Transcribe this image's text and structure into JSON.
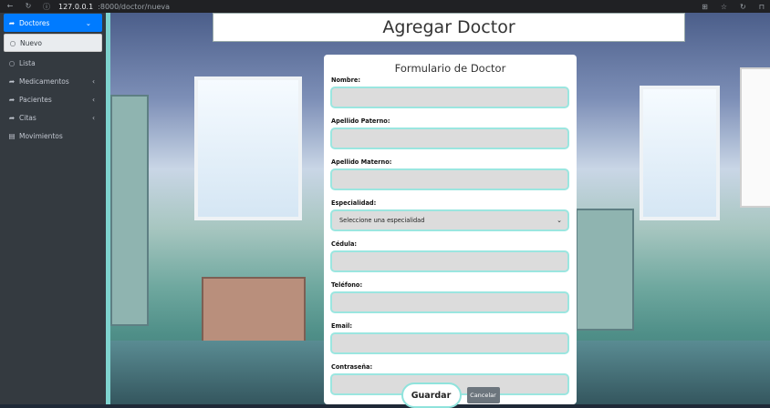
{
  "browser": {
    "url_host": "127.0.0.1",
    "url_path": ":8000/doctor/nueva"
  },
  "sidebar": {
    "items": [
      {
        "label": "Doctores",
        "icon": "share-arrow-icon",
        "caret": "⌄"
      },
      {
        "label": "Nuevo",
        "icon": "circle-icon"
      },
      {
        "label": "Lista",
        "icon": "circle-icon"
      },
      {
        "label": "Medicamentos",
        "icon": "share-arrow-icon",
        "caret": "‹"
      },
      {
        "label": "Pacientes",
        "icon": "share-arrow-icon",
        "caret": "‹"
      },
      {
        "label": "Citas",
        "icon": "share-arrow-icon",
        "caret": "‹"
      },
      {
        "label": "Movimientos",
        "icon": "document-icon"
      }
    ]
  },
  "page": {
    "title": "Agregar Doctor"
  },
  "form": {
    "title": "Formulario de Doctor",
    "fields": {
      "nombre": {
        "label": "Nombre:",
        "value": ""
      },
      "apellido_paterno": {
        "label": "Apellido Paterno:",
        "value": ""
      },
      "apellido_materno": {
        "label": "Apellido Materno:",
        "value": ""
      },
      "especialidad": {
        "label": "Especialidad:",
        "selected": "Seleccione una especialidad"
      },
      "cedula": {
        "label": "Cédula:",
        "value": ""
      },
      "telefono": {
        "label": "Teléfono:",
        "value": ""
      },
      "email": {
        "label": "Email:",
        "value": ""
      },
      "contrasena": {
        "label": "Contraseña:",
        "value": ""
      }
    },
    "buttons": {
      "save": "Guardar",
      "cancel": "Cancelar"
    }
  },
  "colors": {
    "sidebar_bg": "#343a40",
    "active_blue": "#007bff",
    "accent_teal": "#9be6e0",
    "cancel_gray": "#6c757d"
  }
}
